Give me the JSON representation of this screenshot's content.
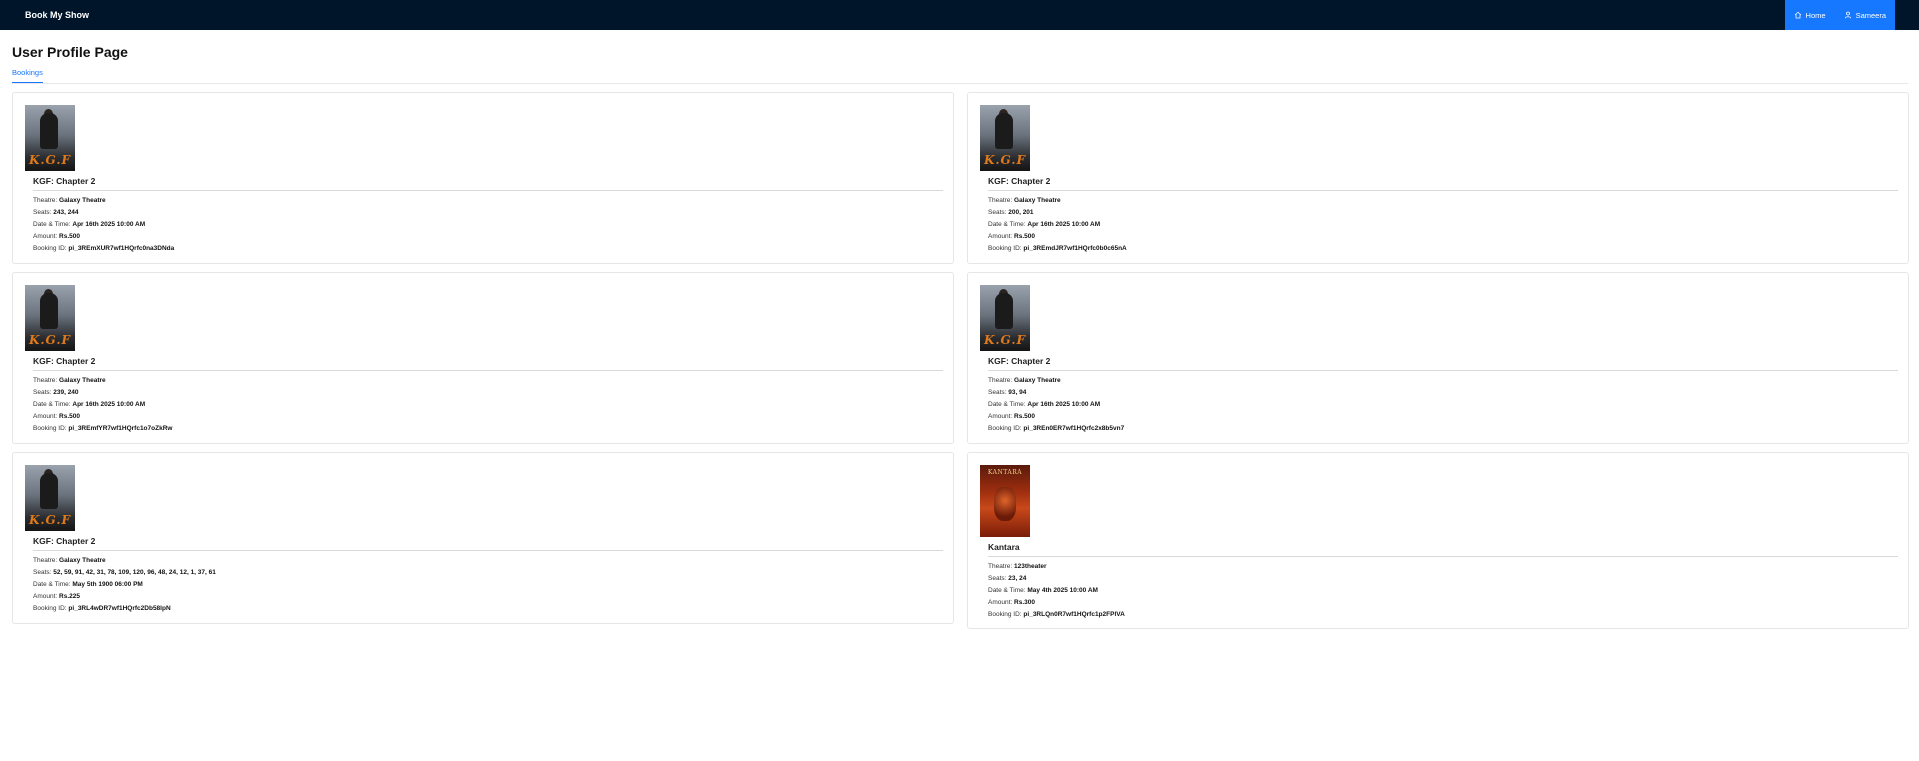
{
  "nav": {
    "brand": "Book My Show",
    "items": [
      {
        "label": "Home",
        "icon": "home-icon"
      },
      {
        "label": "Sameera",
        "icon": "user-icon"
      }
    ]
  },
  "page": {
    "title": "User Profile Page",
    "tabs": [
      "Bookings"
    ]
  },
  "labels": {
    "theatre": "Theatre: ",
    "seats": "Seats: ",
    "datetime": "Date & Time: ",
    "amount": "Amount: ",
    "booking_id": "Booking ID: "
  },
  "bookings": [
    {
      "movie": "KGF: Chapter 2",
      "poster_text": "K.G.F",
      "theatre": "Galaxy Theatre",
      "seats": "243, 244",
      "datetime": "Apr 16th 2025 10:00 AM",
      "amount": "Rs.500",
      "booking_id": "pi_3REmXUR7wf1HQrfc0na3DNda"
    },
    {
      "movie": "KGF: Chapter 2",
      "poster_text": "K.G.F",
      "theatre": "Galaxy Theatre",
      "seats": "200, 201",
      "datetime": "Apr 16th 2025 10:00 AM",
      "amount": "Rs.500",
      "booking_id": "pi_3REmdJR7wf1HQrfc0b0c65nA"
    },
    {
      "movie": "KGF: Chapter 2",
      "poster_text": "K.G.F",
      "theatre": "Galaxy Theatre",
      "seats": "239, 240",
      "datetime": "Apr 16th 2025 10:00 AM",
      "amount": "Rs.500",
      "booking_id": "pi_3REmfYR7wf1HQrfc1o7oZkRw"
    },
    {
      "movie": "KGF: Chapter 2",
      "poster_text": "K.G.F",
      "theatre": "Galaxy Theatre",
      "seats": "93, 94",
      "datetime": "Apr 16th 2025 10:00 AM",
      "amount": "Rs.500",
      "booking_id": "pi_3REn0ER7wf1HQrfc2x8b5vn7"
    },
    {
      "movie": "KGF: Chapter 2",
      "poster_text": "K.G.F",
      "theatre": "Galaxy Theatre",
      "seats": "52, 59, 91, 42, 31, 78, 109, 120, 96, 48, 24, 12, 1, 37, 61",
      "datetime": "May 5th 1900 06:00 PM",
      "amount": "Rs.225",
      "booking_id": "pi_3RL4wDR7wf1HQrfc2Db58lpN"
    },
    {
      "movie": "Kantara",
      "poster_text": "KANTARA",
      "theatre": "123theater",
      "seats": "23, 24",
      "datetime": "May 4th 2025 10:00 AM",
      "amount": "Rs.300",
      "booking_id": "pi_3RLQn0R7wf1HQrfc1p2FPlVA"
    }
  ]
}
